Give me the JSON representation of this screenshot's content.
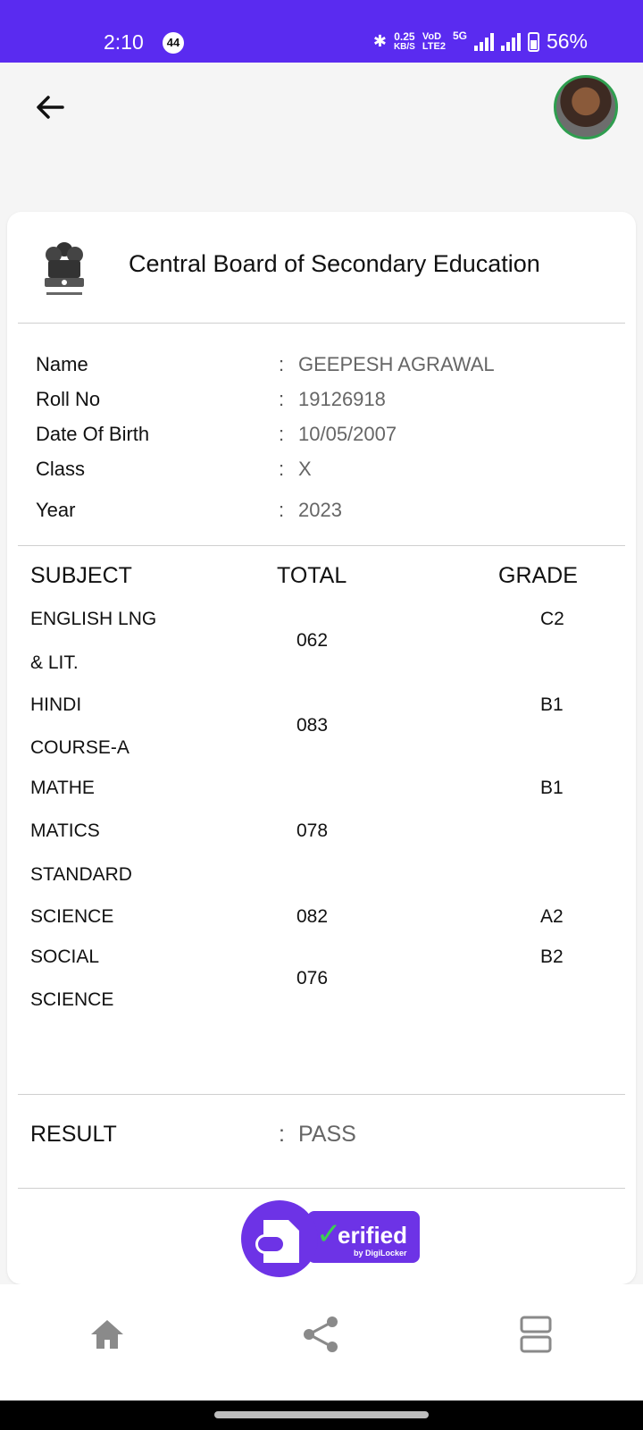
{
  "status_bar": {
    "time": "2:10",
    "notification_count": "44",
    "net_speed_value": "0.25",
    "net_speed_unit": "KB/S",
    "volte_top": "VoD",
    "volte_bottom": "LTE2",
    "network_type": "5G",
    "battery": "56%"
  },
  "certificate": {
    "board_name": "Central Board of Secondary Education",
    "fields": [
      {
        "label": "Name",
        "value": "GEEPESH AGRAWAL"
      },
      {
        "label": "Roll No",
        "value": "19126918"
      },
      {
        "label": "Date Of Birth",
        "value": "10/05/2007"
      },
      {
        "label": "Class",
        "value": "X"
      },
      {
        "label": "Year",
        "value": "2023"
      }
    ],
    "colon": ":",
    "table_headers": {
      "subject": "SUBJECT",
      "total": "TOTAL",
      "grade": "GRADE"
    },
    "subjects": [
      {
        "name_lines": [
          "ENGLISH LNG",
          "& LIT."
        ],
        "total": "062",
        "grade": "C2"
      },
      {
        "name_lines": [
          "HINDI",
          "COURSE-A"
        ],
        "total": "083",
        "grade": "B1"
      },
      {
        "name_lines": [
          "MATHE",
          "MATICS",
          "STANDARD"
        ],
        "total": "078",
        "grade": "B1"
      },
      {
        "name_lines": [
          "SCIENCE"
        ],
        "total": "082",
        "grade": "A2"
      },
      {
        "name_lines": [
          "SOCIAL",
          "SCIENCE"
        ],
        "total": "076",
        "grade": "B2"
      }
    ],
    "result_label": "RESULT",
    "result_value": "PASS"
  },
  "verified_badge": {
    "text": "erified",
    "sub": "by DigiLocker"
  },
  "bottom_nav": [
    {
      "icon": "home-icon"
    },
    {
      "icon": "share-icon"
    },
    {
      "icon": "layout-icon"
    }
  ],
  "colors": {
    "status_bar": "#5a2bf0",
    "badge_purple": "#6d33e6",
    "check_green": "#3ccf52",
    "avatar_ring": "#2f9e4f"
  }
}
